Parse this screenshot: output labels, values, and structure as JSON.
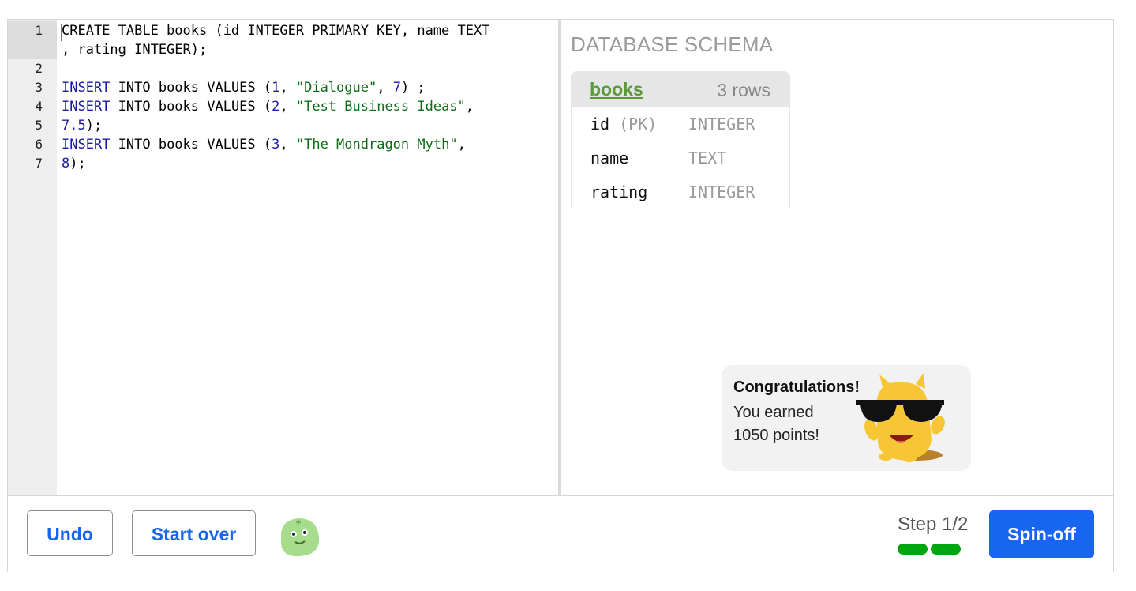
{
  "editor": {
    "line_numbers": [
      "1",
      "2",
      "3",
      "4",
      "5",
      "6",
      "7"
    ],
    "lines": [
      [
        {
          "t": "CREATE TABLE books (id INTEGER PRIMARY KEY, name TEXT",
          "c": "plain"
        }
      ],
      [
        {
          "t": ", rating INTEGER);",
          "c": "plain"
        }
      ],
      [
        {
          "t": "",
          "c": "plain"
        }
      ],
      [
        {
          "t": "INSERT",
          "c": "kw"
        },
        {
          "t": " INTO books VALUES (",
          "c": "plain"
        },
        {
          "t": "1",
          "c": "num"
        },
        {
          "t": ", ",
          "c": "plain"
        },
        {
          "t": "\"Dialogue\"",
          "c": "str"
        },
        {
          "t": ", ",
          "c": "plain"
        },
        {
          "t": "7",
          "c": "num"
        },
        {
          "t": ") ;",
          "c": "plain"
        }
      ],
      [
        {
          "t": "INSERT",
          "c": "kw"
        },
        {
          "t": " INTO books VALUES (",
          "c": "plain"
        },
        {
          "t": "2",
          "c": "num"
        },
        {
          "t": ", ",
          "c": "plain"
        },
        {
          "t": "\"Test Business Ideas\"",
          "c": "str"
        },
        {
          "t": ",",
          "c": "plain"
        }
      ],
      [
        {
          "t": "7.5",
          "c": "num"
        },
        {
          "t": ");",
          "c": "plain"
        }
      ],
      [
        {
          "t": "INSERT",
          "c": "kw"
        },
        {
          "t": " INTO books VALUES (",
          "c": "plain"
        },
        {
          "t": "3",
          "c": "num"
        },
        {
          "t": ", ",
          "c": "plain"
        },
        {
          "t": "\"The Mondragon Myth\"",
          "c": "str"
        },
        {
          "t": ",",
          "c": "plain"
        }
      ],
      [
        {
          "t": "8",
          "c": "num"
        },
        {
          "t": ");",
          "c": "plain"
        }
      ]
    ]
  },
  "schema": {
    "title": "DATABASE SCHEMA",
    "table": {
      "name": "books",
      "row_count": "3 rows",
      "columns": [
        {
          "name": "id",
          "pk": "(PK)",
          "type": "INTEGER"
        },
        {
          "name": "name",
          "pk": "",
          "type": "TEXT"
        },
        {
          "name": "rating",
          "pk": "",
          "type": "INTEGER"
        }
      ]
    }
  },
  "congrats": {
    "title": "Congratulations!",
    "message": "You earned 1050 points!"
  },
  "footer": {
    "undo_label": "Undo",
    "start_over_label": "Start over",
    "step_label": "Step 1/2",
    "steps_completed": 2,
    "steps_total": 2,
    "spinoff_label": "Spin-off"
  },
  "colors": {
    "accent_blue": "#1865f2",
    "progress_green": "#00a60e",
    "table_name_green": "#5a9a3b",
    "keyword_blue": "#1a1aa6",
    "string_green": "#0b6e13"
  },
  "icons": {
    "mascot": "sunglasses-monster-icon",
    "avatar": "green-blob-avatar-icon"
  }
}
